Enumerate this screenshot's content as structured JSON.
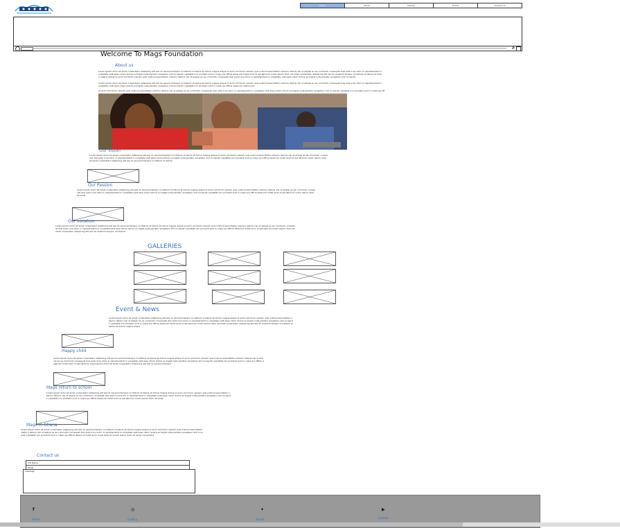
{
  "header": {
    "nav": [
      "Home",
      "About",
      "Gallery",
      "Event",
      "Contact us"
    ],
    "active_index": 0
  },
  "main": {
    "title": "Welcome To Mags Foundation",
    "about": {
      "heading": "About us",
      "p1": "Lorem ipsum dolor sit amet consectetur adipiscing elit sed do eiusmod tempor incididunt ut labore et dolore magna aliqua ut enim ad minim veniam quis nostrud exercitation ullamco laboris nisi ut aliquip ex ea commodo consequat duis aute irure dolor in reprehenderit in voluptate velit esse cillum dolore eu fugiat nulla pariatur excepteur sint occaecat cupidatat non proident sunt in culpa qui officia deserunt mollit anim id est laborum lorem ipsum dolor sit amet consectetur adipiscing elit sed do eiusmod tempor incididunt ut labore et dolore magna aliqua ut enim ad minim veniam quis nostrud exercitation ullamco laboris nisi ut aliquip ex ea commodo consequat duis aute irure dolor in reprehenderit in voluptate velit esse cillum dolore eu fugiat nulla pariatur excepteur sint occaecat",
      "p2": "Lorem ipsum dolor sit amet consectetur adipiscing elit sed do eiusmod tempor incididunt ut labore et dolore magna aliqua ut enim ad minim veniam quis nostrud exercitation ullamco laboris nisi ut aliquip ex ea commodo consequat duis aute irure dolor in reprehenderit in voluptate velit esse cillum dolore eu fugiat nulla pariatur excepteur sint occaecat cupidatat non proident sunt in culpa qui officia deserunt mollit anim",
      "p3": "Ut enim ad minim veniam quis nostrud exercitation ullamco laboris nisi ut aliquip ex ea commodo consequat duis aute irure dolor in reprehenderit in voluptate velit esse cillum dolore eu fugiat nulla pariatur excepteur sint occaecat cupidatat non proident sunt in culpa qui officia deserunt mollit anim id est laborum"
    },
    "vision": {
      "heading": "Our Vision",
      "text": "Lorem ipsum dolor sit amet consectetur adipiscing elit sed do eiusmod tempor incididunt ut labore et dolore magna aliqua ut enim ad minim veniam quis nostrud exercitation ullamco laboris nisi ut aliquip ex ea commodo consequat duis aute irure dolor in reprehenderit in voluptate velit esse cillum dolore eu fugiat nulla pariatur excepteur sint occaecat cupidatat non proident sunt in culpa qui officia deserunt mollit anim id est laborum lorem ipsum dolor sit amet consectetur adipiscing elit sed do eiusmod tempor incididunt ut labore"
    },
    "passion": {
      "heading": "Our Passion",
      "text": "Lorem ipsum dolor sit amet consectetur adipiscing elit sed do eiusmod tempor incididunt ut labore et dolore magna aliqua ut enim ad minim veniam quis nostrud exercitation ullamco laboris nisi ut aliquip ex ea commodo consequat duis aute irure dolor in reprehenderit in voluptate velit esse cillum dolore eu fugiat nulla pariatur excepteur sint occaecat cupidatat non proident sunt in culpa qui officia deserunt mollit anim id est laborum lorem ipsum dolor sit amet"
    },
    "vocation": {
      "heading": "Our vocation",
      "text": "Lorem ipsum dolor sit amet consectetur adipiscing elit sed do eiusmod tempor incididunt ut labore et dolore magna aliqua ut enim ad minim veniam quis nostrud exercitation ullamco laboris nisi ut aliquip ex ea commodo consequat duis aute irure dolor in reprehenderit in voluptate velit esse cillum dolore eu fugiat nulla pariatur excepteur sint occaecat cupidatat non proident sunt in culpa qui officia deserunt mollit anim id est laborum lorem ipsum dolor sit amet consectetur adipiscing elit sed do eiusmod tempor incididunt"
    },
    "galleries": {
      "heading": "GALLERIES"
    },
    "events": {
      "heading": "Event & News",
      "text": "Lorem ipsum dolor sit amet consectetur adipiscing elit sed do eiusmod tempor incididunt ut labore et dolore magna aliqua ut enim ad minim veniam quis nostrud exercitation ullamco laboris nisi ut aliquip ex ea commodo consequat duis aute irure dolor in reprehenderit in voluptate velit esse cillum dolore eu fugiat nulla pariatur excepteur sint occaecat cupidatat non proident sunt in culpa qui officia deserunt mollit anim id est laborum lorem ipsum dolor sit amet consectetur adipiscing elit sed do eiusmod tempor incididunt ut labore et dolore magna aliqua",
      "items": [
        {
          "heading": "Happy child",
          "text": "Lorem ipsum dolor sit amet consectetur adipiscing elit sed do eiusmod tempor incididunt ut labore et dolore magna aliqua ut enim ad minim veniam quis nostrud exercitation ullamco laboris nisi ut aliquip ex ea commodo consequat duis aute irure dolor in reprehenderit in voluptate velit esse cillum dolore eu fugiat nulla pariatur excepteur sint occaecat cupidatat non proident sunt in culpa qui officia deserunt mollit anim id est laborum lorem ipsum dolor sit amet consectetur adipiscing elit sed do eiusmod tempor"
        },
        {
          "heading": "Mags return to school",
          "text": "Lorem ipsum dolor sit amet consectetur adipiscing elit sed do eiusmod tempor incididunt ut labore et dolore magna aliqua ut enim ad minim veniam quis nostrud exercitation ullamco laboris nisi ut aliquip ex ea commodo consequat duis aute irure dolor in reprehenderit in voluptate velit esse cillum dolore eu fugiat nulla pariatur excepteur sint occaecat cupidatat non proident sunt in culpa qui officia deserunt mollit anim id est laborum lorem ipsum dolor sit amet"
        },
        {
          "heading": "Mags in Ghana",
          "text": "Lorem ipsum dolor sit amet consectetur adipiscing elit sed do eiusmod tempor incididunt ut labore et dolore magna aliqua ut enim ad minim veniam quis nostrud exercitation ullamco laboris nisi ut aliquip ex ea commodo consequat duis aute irure dolor in reprehenderit in voluptate velit esse cillum dolore eu fugiat nulla pariatur excepteur sint occaecat cupidatat non proident sunt in culpa qui officia deserunt mollit anim id est laborum lorem ipsum dolor sit amet consectetur"
        }
      ]
    },
    "contact": {
      "heading": "Contact us",
      "name_placeholder": "Full Name",
      "email_placeholder": "Email",
      "message_placeholder": "message"
    }
  },
  "footer": {
    "items": [
      {
        "icon": "facebook-icon",
        "label": "Home"
      },
      {
        "icon": "instagram-icon",
        "label": "Gallery"
      },
      {
        "icon": "twitter-icon",
        "label": "Event"
      },
      {
        "icon": "youtube-icon",
        "label": "Contact"
      }
    ]
  },
  "colors": {
    "accent": "#3a6fc4",
    "footer_bg": "#999999",
    "nav_active": "#8fb3e0"
  }
}
